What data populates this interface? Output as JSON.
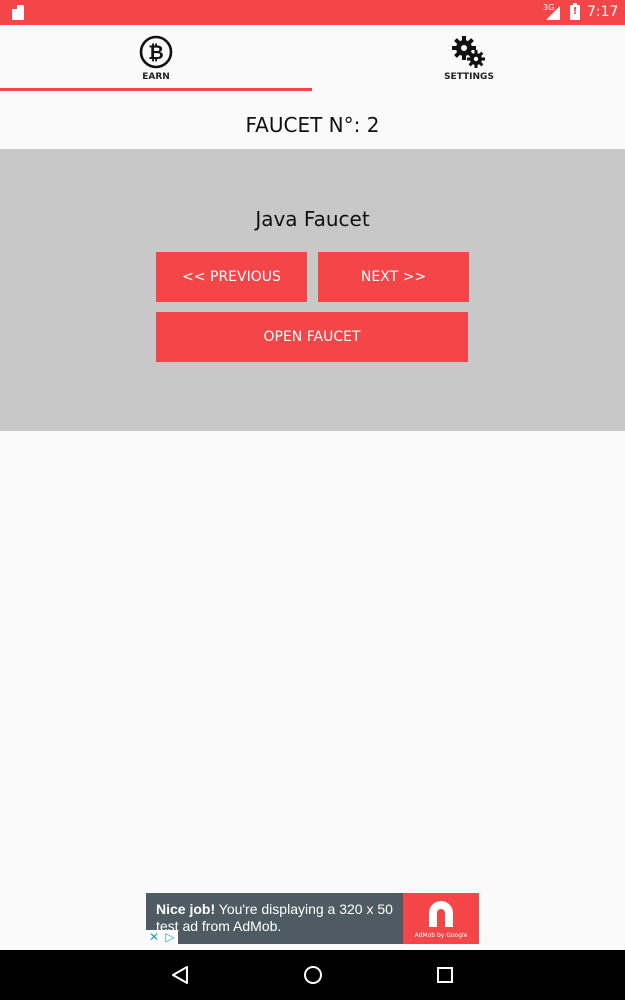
{
  "status_bar": {
    "network": "3G",
    "time": "7:17",
    "color": "#f44548"
  },
  "tabs": [
    {
      "label": "EARN",
      "icon": "bitcoin-icon",
      "selected": true
    },
    {
      "label": "SETTINGS",
      "icon": "gears-icon",
      "selected": false
    }
  ],
  "page": {
    "title": "FAUCET N°: 2"
  },
  "faucet": {
    "name": "Java Faucet",
    "previous_label": "<< PREVIOUS",
    "next_label": "NEXT >>",
    "open_label": "OPEN FAUCET"
  },
  "ad": {
    "headline": "Nice job!",
    "body": " You're displaying a 320 x 50 test ad from AdMob.",
    "attribution": "AdMob by Google"
  },
  "nav": {
    "icons": [
      "back-icon",
      "home-icon",
      "recents-icon"
    ]
  },
  "colors": {
    "accent": "#f44548",
    "panel": "#c9c8c9",
    "background": "#fafafa",
    "ad_background": "#4f5b62"
  }
}
